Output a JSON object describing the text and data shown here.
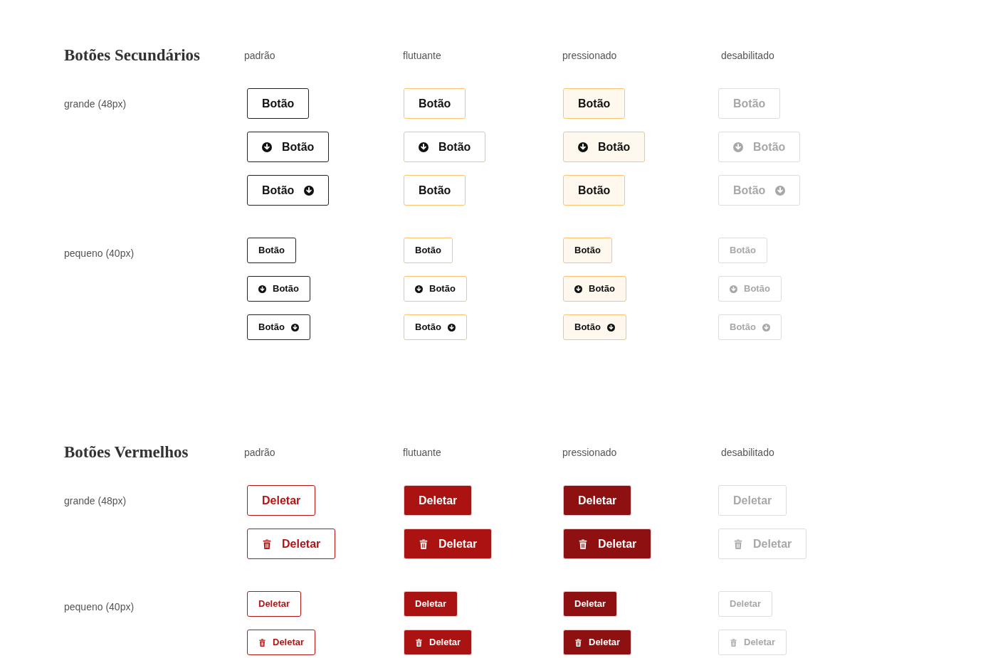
{
  "sections": [
    {
      "title": "Botões Secundários",
      "kind": "secondary",
      "columns": [
        {
          "label": "padrão",
          "kind": "default"
        },
        {
          "label": "flutuante",
          "kind": "hover"
        },
        {
          "label": "pressionado",
          "kind": "pressed"
        },
        {
          "label": "desabilitado",
          "kind": "disabled"
        }
      ],
      "groups": [
        {
          "label": "grande (48px)",
          "kind": "large",
          "rows": [
            [
              {
                "label": "Botão",
                "kind": "text"
              },
              {
                "label": "Botão",
                "kind": "text"
              },
              {
                "label": "Botão",
                "kind": "text"
              },
              {
                "label": "Botão",
                "kind": "text"
              }
            ],
            [
              {
                "label": "Botão",
                "kind": "leading"
              },
              {
                "label": "Botão",
                "kind": "leading"
              },
              {
                "label": "Botão",
                "kind": "leading"
              },
              {
                "label": "Botão",
                "kind": "leading"
              }
            ],
            [
              {
                "label": "Botão",
                "kind": "trailing"
              },
              {
                "label": "Botão",
                "kind": "text"
              },
              {
                "label": "Botão",
                "kind": "text"
              },
              {
                "label": "Botão",
                "kind": "trailing"
              }
            ]
          ]
        },
        {
          "label": "pequeno (40px)",
          "kind": "small",
          "rows": [
            [
              {
                "label": "Botão",
                "kind": "text"
              },
              {
                "label": "Botão",
                "kind": "text"
              },
              {
                "label": "Botão",
                "kind": "text"
              },
              {
                "label": "Botão",
                "kind": "text"
              }
            ],
            [
              {
                "label": "Botão",
                "kind": "leading"
              },
              {
                "label": "Botão",
                "kind": "leading"
              },
              {
                "label": "Botão",
                "kind": "leading"
              },
              {
                "label": "Botão",
                "kind": "leading"
              }
            ],
            [
              {
                "label": "Botão",
                "kind": "trailing"
              },
              {
                "label": "Botão",
                "kind": "trailing"
              },
              {
                "label": "Botão",
                "kind": "trailing"
              },
              {
                "label": "Botão",
                "kind": "trailing"
              }
            ]
          ]
        }
      ]
    },
    {
      "title": "Botões Vermelhos",
      "kind": "red",
      "columns": [
        {
          "label": "padrão",
          "kind": "default"
        },
        {
          "label": "flutuante",
          "kind": "hover"
        },
        {
          "label": "pressionado",
          "kind": "pressed"
        },
        {
          "label": "desabilitado",
          "kind": "disabled"
        }
      ],
      "groups": [
        {
          "label": "grande (48px)",
          "kind": "large",
          "rows": [
            [
              {
                "label": "Deletar",
                "kind": "text"
              },
              {
                "label": "Deletar",
                "kind": "text"
              },
              {
                "label": "Deletar",
                "kind": "text"
              },
              {
                "label": "Deletar",
                "kind": "text"
              }
            ],
            [
              {
                "label": "Deletar",
                "kind": "leading"
              },
              {
                "label": "Deletar",
                "kind": "leading"
              },
              {
                "label": "Deletar",
                "kind": "leading"
              },
              {
                "label": "Deletar",
                "kind": "leading"
              }
            ]
          ]
        },
        {
          "label": "pequeno (40px)",
          "kind": "small",
          "rows": [
            [
              {
                "label": "Deletar",
                "kind": "text"
              },
              {
                "label": "Deletar",
                "kind": "text"
              },
              {
                "label": "Deletar",
                "kind": "text"
              },
              {
                "label": "Deletar",
                "kind": "text"
              }
            ],
            [
              {
                "label": "Deletar",
                "kind": "leading"
              },
              {
                "label": "Deletar",
                "kind": "leading"
              },
              {
                "label": "Deletar",
                "kind": "leading"
              },
              {
                "label": "Deletar",
                "kind": "leading"
              }
            ]
          ]
        }
      ]
    }
  ]
}
